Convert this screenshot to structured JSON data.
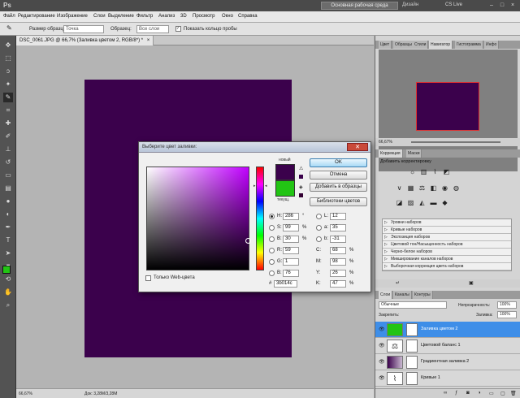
{
  "appbar": {
    "logo": "Ps",
    "workspace": "Основная рабочая среда",
    "design": "Дизайн",
    "cslive": "CS Live",
    "min": "–",
    "max": "□",
    "close": "×"
  },
  "menu": [
    "Файл",
    "Редактирование",
    "Изображение",
    "Слои",
    "Выделение",
    "Фильтр",
    "Анализ",
    "3D",
    "Просмотр",
    "Окно",
    "Справка"
  ],
  "options": {
    "size_label": "Размер образца:",
    "size_value": "Точка",
    "sample_label": "Образец:",
    "sample_value": "Все слои",
    "ring_label": "Показать кольцо пробы"
  },
  "doc": {
    "tab": "DSC_0061.JPG @ 66,7% (Заливка цветом 2, RGB/8*) *",
    "close": "×",
    "fill_color": "#3b014c"
  },
  "status": {
    "zoom": "66,67%",
    "doc": "Док: 3,28M/3,28M"
  },
  "panels": {
    "top_tabs": [
      "Цвет",
      "Образцы",
      "Стили",
      "Навигатор",
      "Гистограмма",
      "Инфо"
    ],
    "nav_zoom": "66,67%",
    "adj_tabs": [
      "Коррекция",
      "Маски"
    ],
    "adj_title": "Добавить корректировку",
    "presets": [
      "Уровни наборов",
      "Кривые наборов",
      "Экспозиция наборов",
      "Цветовой тон/Насыщенность наборов",
      "Черно-белое наборов",
      "Микширование каналов наборов",
      "Выборочная коррекция цвета наборов"
    ],
    "layers_tabs": [
      "Слои",
      "Каналы",
      "Контуры"
    ],
    "blend": "Обычные",
    "opacity_label": "Непрозрачность:",
    "opacity": "100%",
    "lock_label": "Закрепить:",
    "fill_label": "Заливка:",
    "fill": "100%",
    "layers": [
      {
        "name": "Заливка цветом 2",
        "selected": true
      },
      {
        "name": "Цветовой баланс 1",
        "selected": false
      },
      {
        "name": "Градиентная заливка 2",
        "selected": false
      },
      {
        "name": "Кривые 1",
        "selected": false
      }
    ]
  },
  "dialog": {
    "title": "Выберите цвет заливки:",
    "close": "✕",
    "new_label": "новый",
    "current_label": "текущ.",
    "new_color": "#3b014c",
    "current_color": "#22c414",
    "buttons": {
      "ok": "OK",
      "cancel": "Отмена",
      "add": "Добавить в образцы",
      "libraries": "Библиотеки цветов"
    },
    "web_only": "Только Web-цвета",
    "fields": {
      "H": {
        "value": "286",
        "unit": "°"
      },
      "S": {
        "value": "99",
        "unit": "%"
      },
      "Bv": {
        "value": "30",
        "unit": "%"
      },
      "R": {
        "value": "59",
        "unit": ""
      },
      "G": {
        "value": "1",
        "unit": ""
      },
      "B": {
        "value": "76",
        "unit": ""
      },
      "L": {
        "value": "12",
        "unit": ""
      },
      "a": {
        "value": "35",
        "unit": ""
      },
      "b": {
        "value": "-31",
        "unit": ""
      },
      "C": {
        "value": "68",
        "unit": "%"
      },
      "M": {
        "value": "98",
        "unit": "%"
      },
      "Y": {
        "value": "26",
        "unit": "%"
      },
      "K": {
        "value": "47",
        "unit": "%"
      }
    },
    "hex": "3b014c"
  }
}
